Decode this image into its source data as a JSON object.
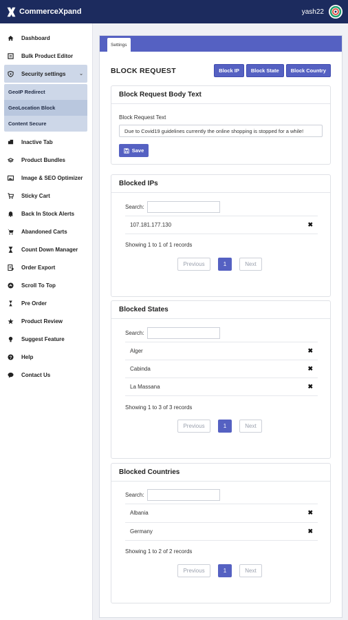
{
  "app": {
    "brand": "CommerceXpand",
    "user": "yash22"
  },
  "sidebar": {
    "items": [
      {
        "label": "Dashboard",
        "icon": "home-icon"
      },
      {
        "label": "Bulk Product Editor",
        "icon": "edit-icon"
      },
      {
        "label": "Security settings",
        "icon": "shield-icon"
      },
      {
        "label": "Inactive Tab",
        "icon": "tab-icon"
      },
      {
        "label": "Product Bundles",
        "icon": "bundle-icon"
      },
      {
        "label": "Image & SEO Optimizer",
        "icon": "image-icon"
      },
      {
        "label": "Sticky Cart",
        "icon": "cart-icon"
      },
      {
        "label": "Back In Stock Alerts",
        "icon": "bell-icon"
      },
      {
        "label": "Abandoned Carts",
        "icon": "cart-icon"
      },
      {
        "label": "Count Down Manager",
        "icon": "hourglass-icon"
      },
      {
        "label": "Order Export",
        "icon": "export-icon"
      },
      {
        "label": "Scroll To Top",
        "icon": "arrow-up-icon"
      },
      {
        "label": "Pre Order",
        "icon": "hourglass-icon"
      },
      {
        "label": "Product Review",
        "icon": "star-icon"
      },
      {
        "label": "Suggest Feature",
        "icon": "lightbulb-icon"
      },
      {
        "label": "Help",
        "icon": "help-icon"
      },
      {
        "label": "Contact Us",
        "icon": "chat-icon"
      }
    ],
    "submenu": [
      "GeoIP Redirect",
      "GeoLocation Block",
      "Content Secure"
    ]
  },
  "main": {
    "tab": "Settings",
    "title": "BLOCK REQUEST",
    "buttons": [
      "Block IP",
      "Block State",
      "Block Country"
    ]
  },
  "body_text": {
    "heading": "Block Request Body Text",
    "label": "Block Request Text",
    "value": "Due to Covid19 guidelines currently the online shopping is stopped for a while!",
    "save": "Save"
  },
  "blocked_ips": {
    "heading": "Blocked IPs",
    "search_label": "Search:",
    "rows": [
      "107.181.177.130"
    ],
    "info": "Showing 1 to 1 of 1 records",
    "prev": "Previous",
    "page": "1",
    "next": "Next"
  },
  "blocked_states": {
    "heading": "Blocked States",
    "search_label": "Search:",
    "rows": [
      "Alger",
      "Cabinda",
      "La Massana"
    ],
    "info": "Showing 1 to 3 of 3 records",
    "prev": "Previous",
    "page": "1",
    "next": "Next"
  },
  "blocked_countries": {
    "heading": "Blocked Countries",
    "search_label": "Search:",
    "rows": [
      "Albania",
      "Germany"
    ],
    "info": "Showing 1 to 2 of 2 records",
    "prev": "Previous",
    "page": "1",
    "next": "Next"
  },
  "colors": {
    "topbar": "#1c2b5e",
    "accent": "#5561c2",
    "active_nav": "#cdd7e8"
  }
}
